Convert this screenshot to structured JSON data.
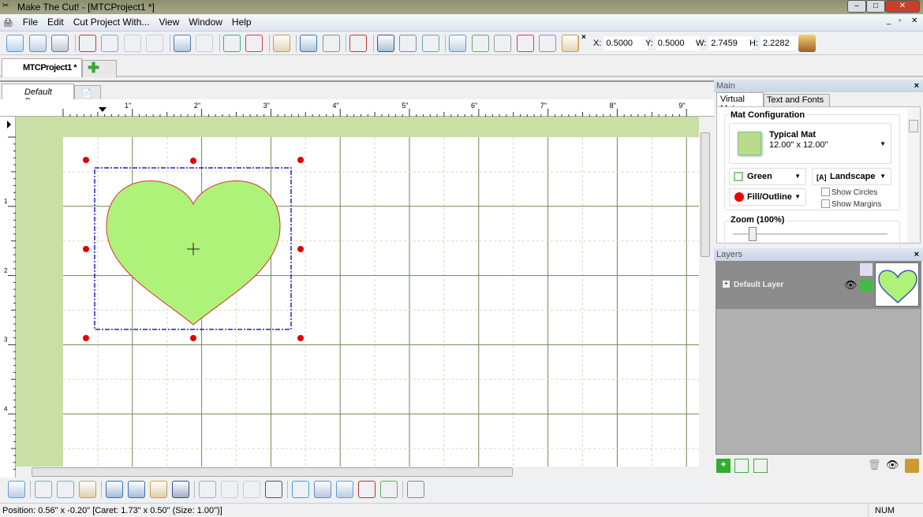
{
  "window": {
    "title": "Make The Cut! - [MTCProject1 *]",
    "controls": [
      "minimize",
      "maximize",
      "close"
    ]
  },
  "menu": [
    "File",
    "Edit",
    "Cut Project With...",
    "View",
    "Window",
    "Help"
  ],
  "toolbar": {
    "icons": [
      "new-icon",
      "open-icon",
      "save-icon",
      "cut-icon",
      "copy-icon",
      "paste-icon",
      "paste-in-place-icon",
      "undo-icon",
      "redo-icon",
      "zoom-in-icon",
      "zoom-out-icon",
      "preview-icon",
      "cut-tool-icon",
      "zoom-fit-icon",
      "trace-icon",
      "ort-icon",
      "grid-icon",
      "shapes-icon",
      "import-icon",
      "pdf-icon",
      "tiff-icon",
      "wpc-icon",
      "gsd-icon",
      "scut-icon"
    ],
    "x_label": "X:",
    "x_value": "0.5000",
    "y_label": "Y:",
    "y_value": "0.5000",
    "w_label": "W:",
    "w_value": "2.7459",
    "h_label": "H:",
    "h_value": "2.2282"
  },
  "project_tab": "MTCProject1 *",
  "page_tab": "Default Page",
  "ruler": {
    "labels": [
      "1\"",
      "2\"",
      "3\"",
      "4\"",
      "5\"",
      "6\"",
      "7\"",
      "8\"",
      "9\""
    ],
    "v_labels": [
      "1",
      "2",
      "3",
      "4"
    ]
  },
  "colors": {
    "mat": "#c9dfa6",
    "shape_fill": "#aef27a",
    "shape_stroke": "#e03030",
    "selection": "#2020c0",
    "handle": "#e00000"
  },
  "right_panel": {
    "main_title": "Main",
    "tabs": [
      "Virtual Mat",
      "Text and Fonts"
    ],
    "mat_config_title": "Mat Configuration",
    "mat_name": "Typical Mat",
    "mat_size": "12.00\" x 12.00\"",
    "color_select": "Green",
    "orientation_select": "Landscape",
    "display_select": "Fill/Outline",
    "show_circles": {
      "label": "Show Circles",
      "checked": false
    },
    "show_margins": {
      "label": "Show Margins",
      "checked": false
    },
    "zoom_label": "Zoom (100%)",
    "zoom_value": 100,
    "layers_title": "Layers",
    "layer_name": "Default Layer"
  },
  "bottom_toolbar": {
    "icons": [
      "select-icon",
      "flip-horizontal-icon",
      "flip-vertical-icon",
      "rotate-icon",
      "align-icon",
      "shear-icon",
      "center-icon",
      "shadow-icon",
      "split-icon",
      "weld-icon",
      "intersect-icon",
      "node-edit-icon",
      "circle-nodes-icon",
      "warp-icon",
      "rectangle-icon",
      "pattern-fill-icon",
      "dot-array-icon",
      "settings-wrench-icon"
    ]
  },
  "status": {
    "position": "Position: 0.56\" x -0.20\" [Caret: 1.73\" x 0.50\" (Size: 1.00\")]",
    "num": "NUM"
  }
}
